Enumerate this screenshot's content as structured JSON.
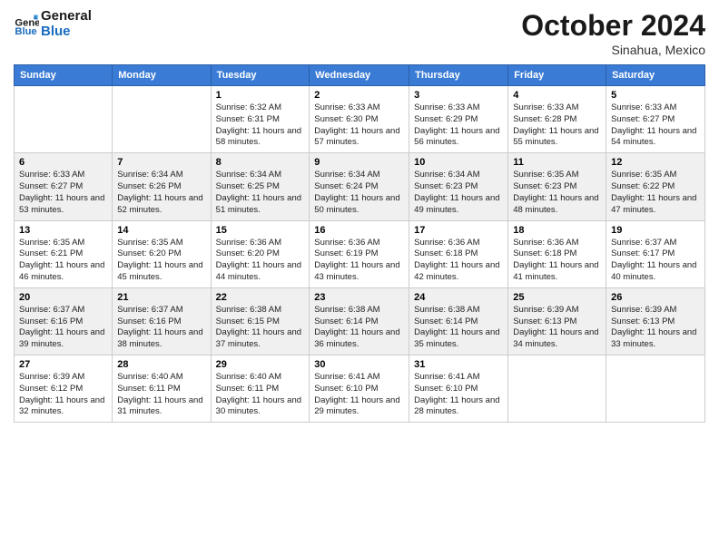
{
  "header": {
    "logo": {
      "text1": "General",
      "text2": "Blue"
    },
    "title": "October 2024",
    "location": "Sinahua, Mexico"
  },
  "weekdays": [
    "Sunday",
    "Monday",
    "Tuesday",
    "Wednesday",
    "Thursday",
    "Friday",
    "Saturday"
  ],
  "weeks": [
    [
      null,
      null,
      {
        "day": 1,
        "sunrise": "6:32 AM",
        "sunset": "6:31 PM",
        "daylight": "11 hours and 58 minutes."
      },
      {
        "day": 2,
        "sunrise": "6:33 AM",
        "sunset": "6:30 PM",
        "daylight": "11 hours and 57 minutes."
      },
      {
        "day": 3,
        "sunrise": "6:33 AM",
        "sunset": "6:29 PM",
        "daylight": "11 hours and 56 minutes."
      },
      {
        "day": 4,
        "sunrise": "6:33 AM",
        "sunset": "6:28 PM",
        "daylight": "11 hours and 55 minutes."
      },
      {
        "day": 5,
        "sunrise": "6:33 AM",
        "sunset": "6:27 PM",
        "daylight": "11 hours and 54 minutes."
      }
    ],
    [
      {
        "day": 6,
        "sunrise": "6:33 AM",
        "sunset": "6:27 PM",
        "daylight": "11 hours and 53 minutes."
      },
      {
        "day": 7,
        "sunrise": "6:34 AM",
        "sunset": "6:26 PM",
        "daylight": "11 hours and 52 minutes."
      },
      {
        "day": 8,
        "sunrise": "6:34 AM",
        "sunset": "6:25 PM",
        "daylight": "11 hours and 51 minutes."
      },
      {
        "day": 9,
        "sunrise": "6:34 AM",
        "sunset": "6:24 PM",
        "daylight": "11 hours and 50 minutes."
      },
      {
        "day": 10,
        "sunrise": "6:34 AM",
        "sunset": "6:23 PM",
        "daylight": "11 hours and 49 minutes."
      },
      {
        "day": 11,
        "sunrise": "6:35 AM",
        "sunset": "6:23 PM",
        "daylight": "11 hours and 48 minutes."
      },
      {
        "day": 12,
        "sunrise": "6:35 AM",
        "sunset": "6:22 PM",
        "daylight": "11 hours and 47 minutes."
      }
    ],
    [
      {
        "day": 13,
        "sunrise": "6:35 AM",
        "sunset": "6:21 PM",
        "daylight": "11 hours and 46 minutes."
      },
      {
        "day": 14,
        "sunrise": "6:35 AM",
        "sunset": "6:20 PM",
        "daylight": "11 hours and 45 minutes."
      },
      {
        "day": 15,
        "sunrise": "6:36 AM",
        "sunset": "6:20 PM",
        "daylight": "11 hours and 44 minutes."
      },
      {
        "day": 16,
        "sunrise": "6:36 AM",
        "sunset": "6:19 PM",
        "daylight": "11 hours and 43 minutes."
      },
      {
        "day": 17,
        "sunrise": "6:36 AM",
        "sunset": "6:18 PM",
        "daylight": "11 hours and 42 minutes."
      },
      {
        "day": 18,
        "sunrise": "6:36 AM",
        "sunset": "6:18 PM",
        "daylight": "11 hours and 41 minutes."
      },
      {
        "day": 19,
        "sunrise": "6:37 AM",
        "sunset": "6:17 PM",
        "daylight": "11 hours and 40 minutes."
      }
    ],
    [
      {
        "day": 20,
        "sunrise": "6:37 AM",
        "sunset": "6:16 PM",
        "daylight": "11 hours and 39 minutes."
      },
      {
        "day": 21,
        "sunrise": "6:37 AM",
        "sunset": "6:16 PM",
        "daylight": "11 hours and 38 minutes."
      },
      {
        "day": 22,
        "sunrise": "6:38 AM",
        "sunset": "6:15 PM",
        "daylight": "11 hours and 37 minutes."
      },
      {
        "day": 23,
        "sunrise": "6:38 AM",
        "sunset": "6:14 PM",
        "daylight": "11 hours and 36 minutes."
      },
      {
        "day": 24,
        "sunrise": "6:38 AM",
        "sunset": "6:14 PM",
        "daylight": "11 hours and 35 minutes."
      },
      {
        "day": 25,
        "sunrise": "6:39 AM",
        "sunset": "6:13 PM",
        "daylight": "11 hours and 34 minutes."
      },
      {
        "day": 26,
        "sunrise": "6:39 AM",
        "sunset": "6:13 PM",
        "daylight": "11 hours and 33 minutes."
      }
    ],
    [
      {
        "day": 27,
        "sunrise": "6:39 AM",
        "sunset": "6:12 PM",
        "daylight": "11 hours and 32 minutes."
      },
      {
        "day": 28,
        "sunrise": "6:40 AM",
        "sunset": "6:11 PM",
        "daylight": "11 hours and 31 minutes."
      },
      {
        "day": 29,
        "sunrise": "6:40 AM",
        "sunset": "6:11 PM",
        "daylight": "11 hours and 30 minutes."
      },
      {
        "day": 30,
        "sunrise": "6:41 AM",
        "sunset": "6:10 PM",
        "daylight": "11 hours and 29 minutes."
      },
      {
        "day": 31,
        "sunrise": "6:41 AM",
        "sunset": "6:10 PM",
        "daylight": "11 hours and 28 minutes."
      },
      null,
      null
    ]
  ]
}
